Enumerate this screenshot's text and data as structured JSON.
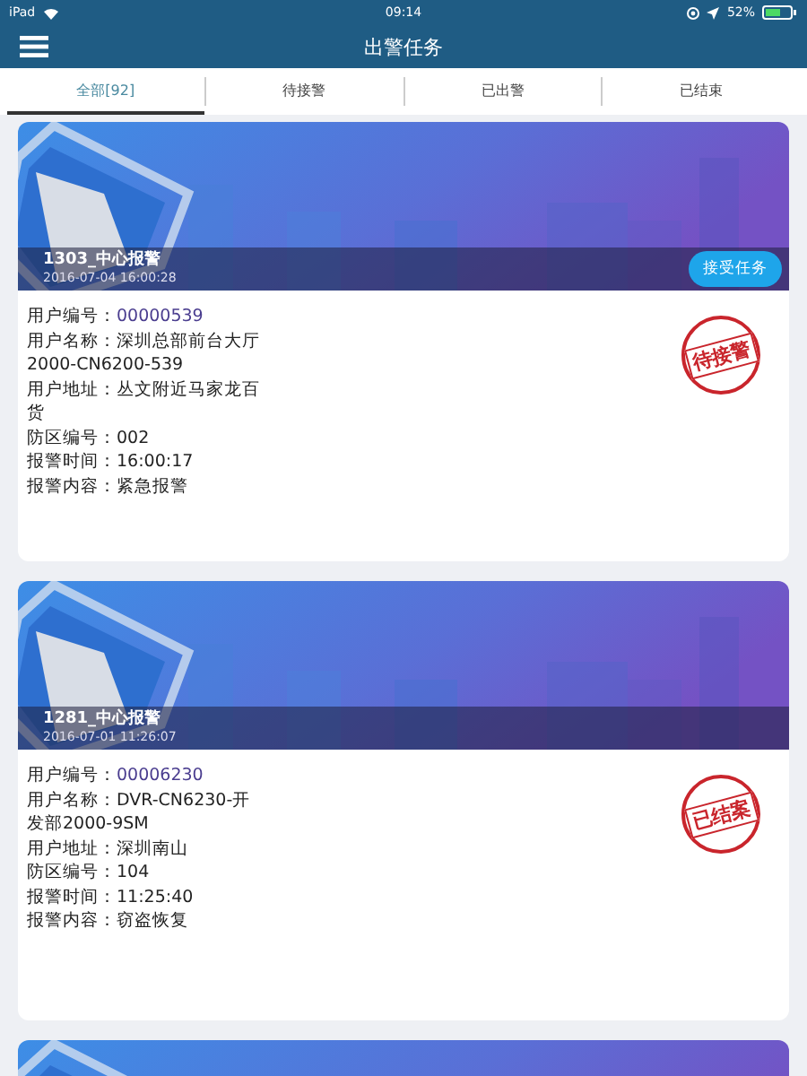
{
  "status_bar": {
    "device": "iPad",
    "time": "09:14",
    "battery": "52%"
  },
  "nav": {
    "title": "出警任务"
  },
  "tabs": [
    {
      "label": "全部[92]",
      "selected": true
    },
    {
      "label": "待接警",
      "selected": false
    },
    {
      "label": "已出警",
      "selected": false
    },
    {
      "label": "已结束",
      "selected": false
    }
  ],
  "cards": [
    {
      "kind": "full",
      "title": "1303_中心报警",
      "time": "2016-07-04 16:00:28",
      "action": "接受任务",
      "stamp": "待接警",
      "fields": [
        {
          "label": "用户编号：",
          "value": "00000539",
          "kind": "id"
        },
        {
          "label": "用户名称：",
          "value": "深圳总部前台大厅2000-CN6200-539",
          "kind": "text"
        },
        {
          "label": "用户地址：",
          "value": "丛文附近马家龙百货",
          "kind": "text"
        },
        {
          "label": "防区编号：",
          "value": "002",
          "kind": "text"
        },
        {
          "label": "报警时间：",
          "value": "16:00:17",
          "kind": "text"
        },
        {
          "label": "报警内容：",
          "value": "紧急报警",
          "kind": "text"
        }
      ]
    },
    {
      "kind": "full",
      "title": "1281_中心报警",
      "time": "2016-07-01 11:26:07",
      "stamp": "已结案",
      "fields": [
        {
          "label": "用户编号：",
          "value": "00006230",
          "kind": "id"
        },
        {
          "label": "用户名称：",
          "value": "DVR-CN6230-开发部2000-9SM",
          "kind": "text"
        },
        {
          "label": "用户地址：",
          "value": "深圳南山",
          "kind": "text"
        },
        {
          "label": "防区编号：",
          "value": "104",
          "kind": "text"
        },
        {
          "label": "报警时间：",
          "value": "11:25:40",
          "kind": "text"
        },
        {
          "label": "报警内容：",
          "value": "窃盗恢复",
          "kind": "text"
        }
      ]
    },
    {
      "kind": "banner_only"
    }
  ]
}
